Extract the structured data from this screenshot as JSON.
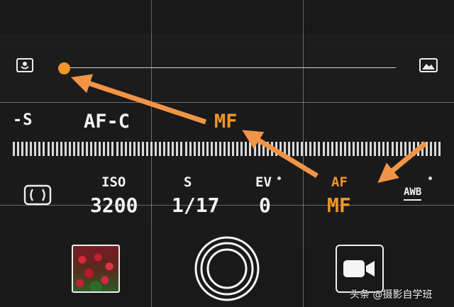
{
  "focus_slider": {
    "left_icon": "macro-flower-icon",
    "right_icon": "landscape-mountain-icon",
    "level": 0.0
  },
  "focus_modes": {
    "mode_s": "-S",
    "mode_afc": "AF-C",
    "mode_mf": "MF"
  },
  "settings": {
    "metering_icon": "metering-bracket-icon",
    "iso_label": "ISO",
    "iso_value": "3200",
    "shutter_label": "S",
    "shutter_value": "1/17",
    "ev_label": "EV",
    "ev_value": "0",
    "af_label": "AF",
    "af_value": "MF",
    "wb_label": "AWB"
  },
  "bottom": {
    "gallery_icon": "gallery-thumbnail",
    "shutter_icon": "shutter-button",
    "video_icon": "video-camera-icon"
  },
  "watermark": {
    "text": "头条 @摄影自学班"
  },
  "colors": {
    "accent": "#f0962a",
    "arrow": "#f29446",
    "text": "#f2f2f2"
  }
}
